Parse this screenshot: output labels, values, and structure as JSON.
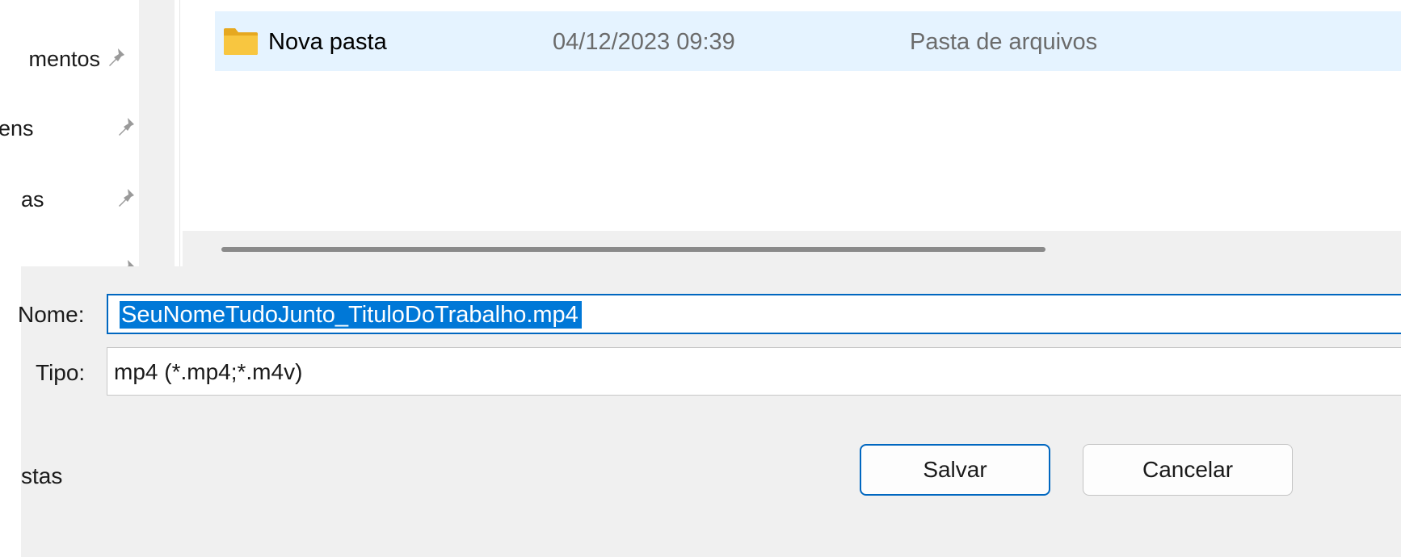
{
  "navigation": {
    "items": [
      {
        "label": "mentos",
        "pinned": true
      },
      {
        "label": "ens",
        "pinned": true
      },
      {
        "label": "as",
        "pinned": true
      },
      {
        "label": "",
        "pinned": true
      }
    ],
    "bottom_item": "stas"
  },
  "file_list": {
    "rows": [
      {
        "name": "Nova pasta",
        "date_modified": "04/12/2023 09:39",
        "type": "Pasta de arquivos",
        "icon": "folder-icon",
        "selected": true
      }
    ]
  },
  "save_form": {
    "filename_label": "Nome:",
    "filename_value": "SeuNomeTudoJunto_TituloDoTrabalho.mp4",
    "filetype_label": "Tipo:",
    "filetype_value": "mp4 (*.mp4;*.m4v)",
    "save_button": "Salvar",
    "cancel_button": "Cancelar"
  },
  "colors": {
    "accent": "#0067c0",
    "selection": "#0078d7",
    "row_highlight": "#e5f3ff",
    "panel_background": "#f0f0f0",
    "folder": "#f8c640"
  }
}
